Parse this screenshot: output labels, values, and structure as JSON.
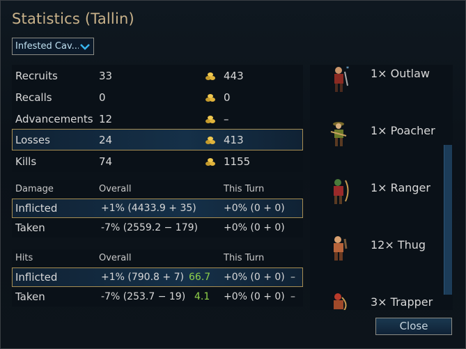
{
  "window": {
    "title": "Statistics (Tallin)"
  },
  "scenario_dropdown": {
    "value": "Infested Cav..."
  },
  "summary": [
    {
      "label": "Recruits",
      "count": "33",
      "gold": "443"
    },
    {
      "label": "Recalls",
      "count": "0",
      "gold": "0"
    },
    {
      "label": "Advancements",
      "count": "12",
      "gold": "–"
    },
    {
      "label": "Losses",
      "count": "24",
      "gold": "413"
    },
    {
      "label": "Kills",
      "count": "74",
      "gold": "1155"
    }
  ],
  "damage": {
    "header": "Damage",
    "col_overall": "Overall",
    "col_turn": "This Turn",
    "rows": [
      {
        "label": "Inflicted",
        "overall": "+1% (4433.9 + 35)",
        "turn": "+0% (0 + 0)"
      },
      {
        "label": "Taken",
        "overall": "-7% (2559.2 − 179)",
        "turn": "+0% (0 + 0)"
      }
    ]
  },
  "hits": {
    "header": "Hits",
    "col_overall": "Overall",
    "col_turn": "This Turn",
    "rows": [
      {
        "label": "Inflicted",
        "overall": "+1% (790.8 + 7)",
        "ratio": "66.7",
        "turn": "+0% (0 + 0)",
        "dash": "–"
      },
      {
        "label": "Taken",
        "overall": "-7% (253.7 − 19)",
        "ratio": "4.1",
        "turn": "+0% (0 + 0)",
        "dash": "–"
      }
    ]
  },
  "units": [
    {
      "label": "1× Outlaw",
      "icon": "outlaw-sprite"
    },
    {
      "label": "1× Poacher",
      "icon": "poacher-sprite"
    },
    {
      "label": "1× Ranger",
      "icon": "ranger-sprite"
    },
    {
      "label": "12× Thug",
      "icon": "thug-sprite"
    },
    {
      "label": "3× Trapper",
      "icon": "trapper-sprite"
    }
  ],
  "buttons": {
    "close": "Close"
  },
  "colors": {
    "title": "#c9b28a",
    "highlight_border": "#a88e52",
    "ratio_green": "#8fd14a"
  }
}
